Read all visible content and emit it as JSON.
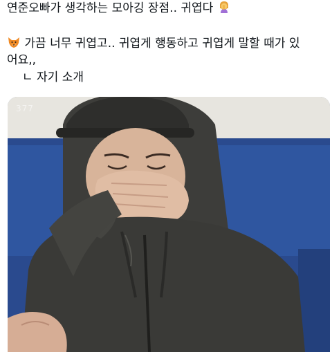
{
  "tweet": {
    "line1": "연준오빠가 생각하는 모아깅 장점.. 귀엽다",
    "line2": "가끔 너무 귀엽고.. 귀엽게 행동하고 귀엽게 말할 때가 있",
    "line3": "어요,,",
    "line4": "ㄴ 자기 소개"
  },
  "media": {
    "watermark": "377"
  },
  "colors": {
    "text": "#0f1419",
    "sofa": "#2c4a8c",
    "hoodie": "#3a3a37"
  }
}
